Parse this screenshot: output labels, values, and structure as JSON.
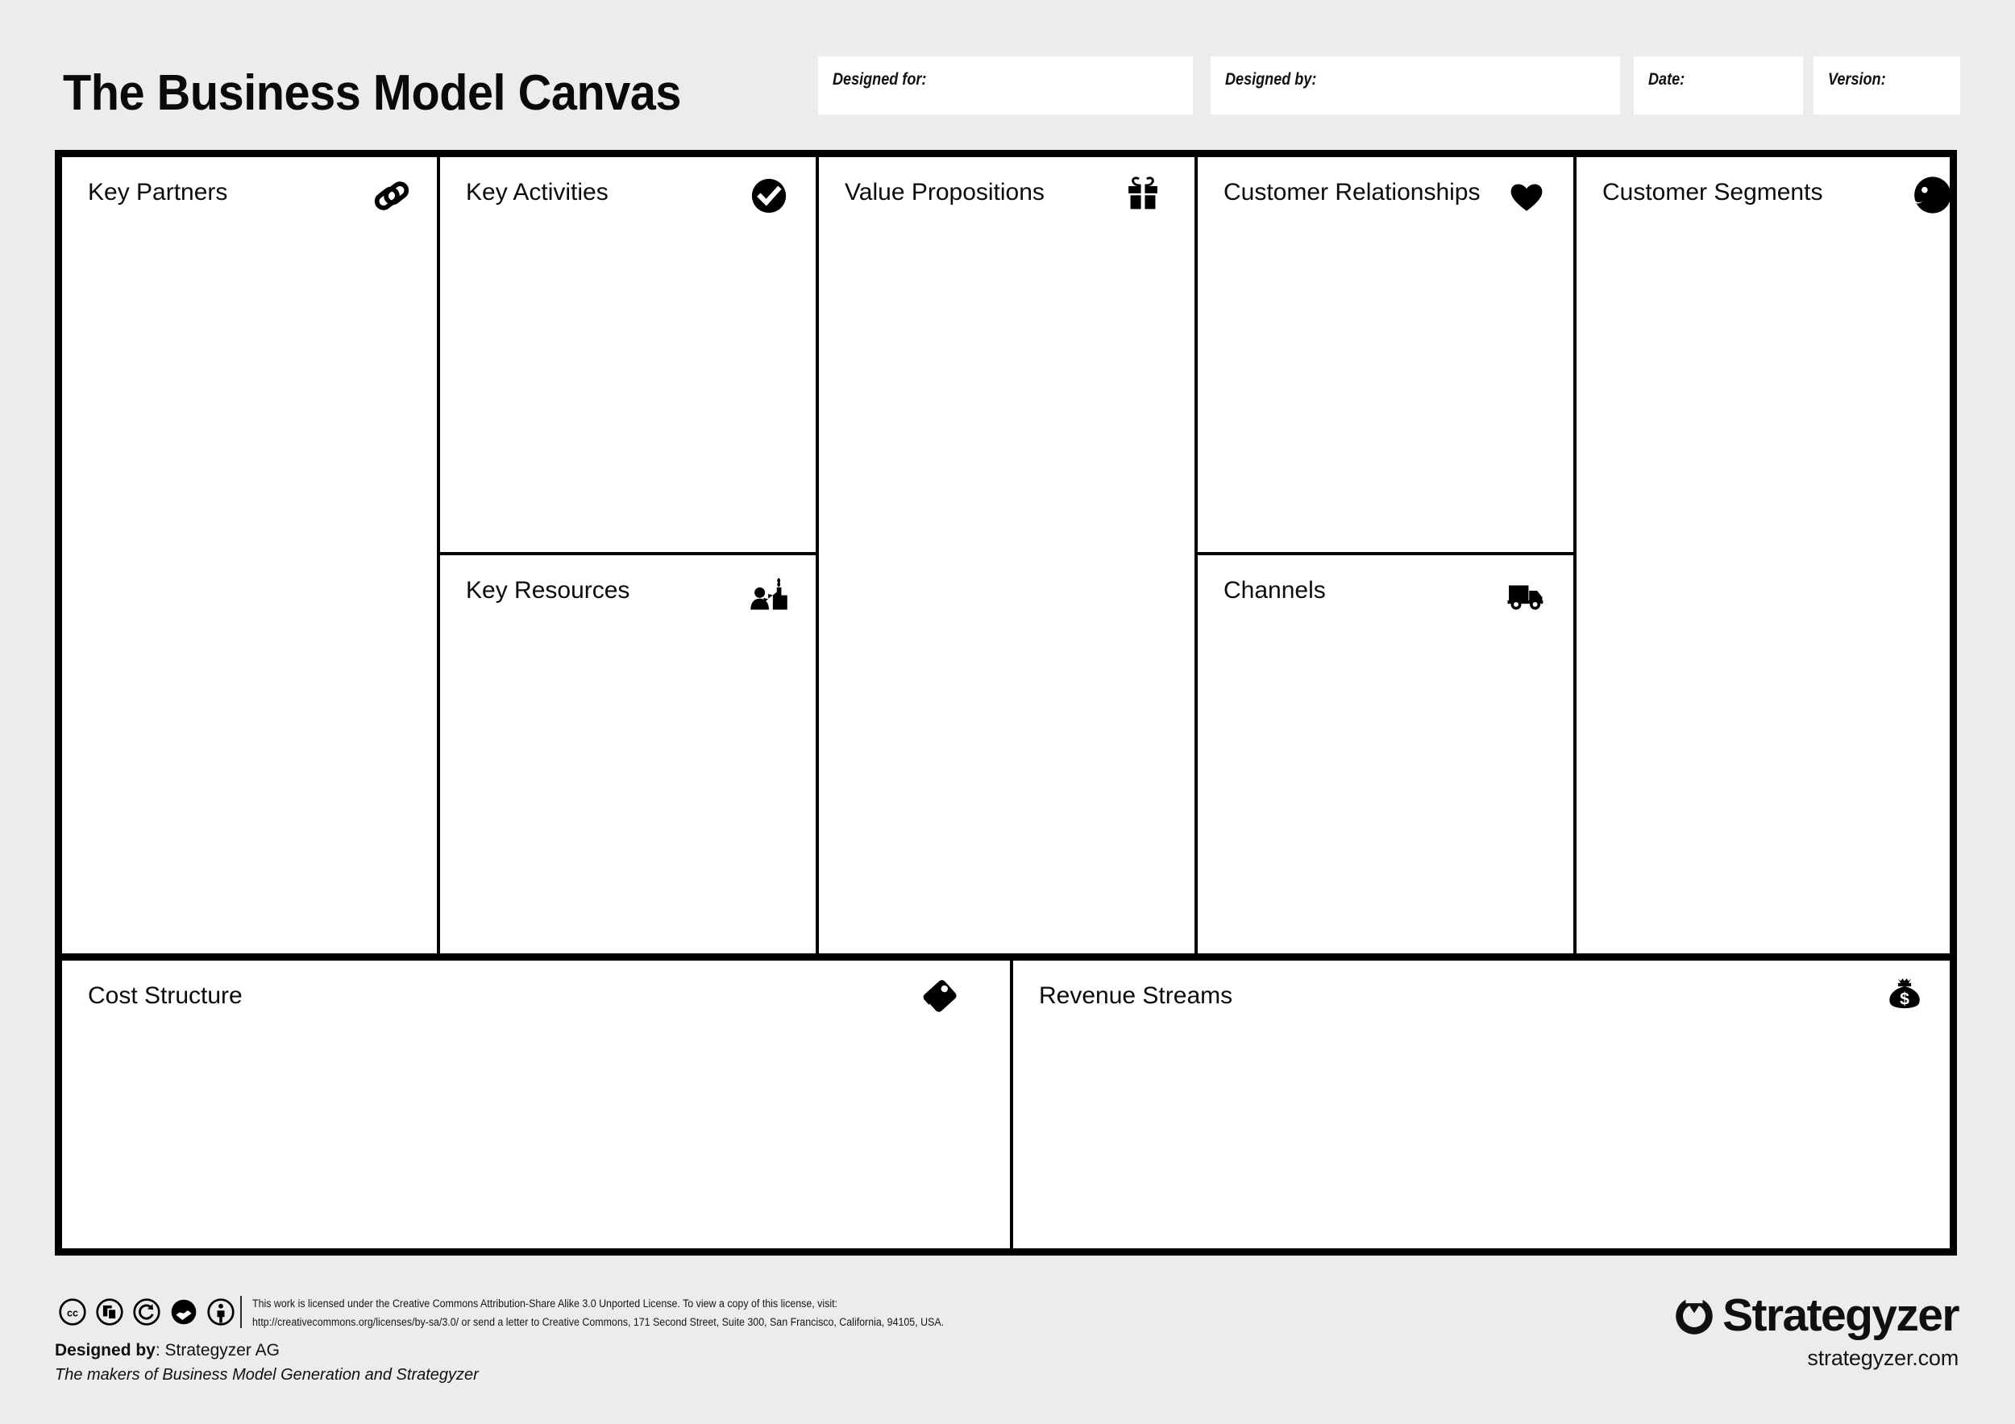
{
  "header": {
    "title": "The Business Model Canvas",
    "fields": [
      {
        "id": "designed-for",
        "label": "Designed for:",
        "value": ""
      },
      {
        "id": "designed-by",
        "label": "Designed by:",
        "value": ""
      },
      {
        "id": "date",
        "label": "Date:",
        "value": ""
      },
      {
        "id": "version",
        "label": "Version:",
        "value": ""
      }
    ]
  },
  "canvas": {
    "blocks": [
      {
        "key": "key-partners",
        "title": "Key Partners",
        "icon": "chain-link-icon",
        "content": ""
      },
      {
        "key": "key-activities",
        "title": "Key Activities",
        "icon": "check-circle-icon",
        "content": ""
      },
      {
        "key": "key-resources",
        "title": "Key Resources",
        "icon": "factory-worker-icon",
        "content": ""
      },
      {
        "key": "value-propositions",
        "title": "Value Propositions",
        "icon": "gift-icon",
        "content": ""
      },
      {
        "key": "customer-relationships",
        "title": "Customer Relationships",
        "icon": "heart-icon",
        "content": ""
      },
      {
        "key": "channels",
        "title": "Channels",
        "icon": "delivery-truck-icon",
        "content": ""
      },
      {
        "key": "customer-segments",
        "title": "Customer Segments",
        "icon": "person-head-icon",
        "content": ""
      },
      {
        "key": "cost-structure",
        "title": "Cost Structure",
        "icon": "price-tag-icon",
        "content": ""
      },
      {
        "key": "revenue-streams",
        "title": "Revenue Streams",
        "icon": "money-bag-icon",
        "content": ""
      }
    ]
  },
  "footer": {
    "cc_badges": [
      "cc-icon",
      "remix-icon",
      "share-alike-icon",
      "adapt-icon",
      "attribution-icon"
    ],
    "license_line1": "This work is licensed under the Creative Commons Attribution-Share Alike 3.0 Unported License. To view a copy of this license, visit:",
    "license_line2": "http://creativecommons.org/licenses/by-sa/3.0/ or send a letter to Creative Commons, 171 Second Street, Suite 300, San Francisco, California, 94105, USA.",
    "designed_by_label": "Designed by",
    "designed_by_value": ": Strategyzer AG",
    "tagline": "The makers of Business Model Generation and Strategyzer",
    "brand_name": "Strategyzer",
    "brand_url": "strategyzer.com"
  },
  "colors": {
    "page_background": "#ececec",
    "canvas_background": "#ffffff",
    "frame_border": "#000000",
    "text": "#0b0b0b"
  }
}
